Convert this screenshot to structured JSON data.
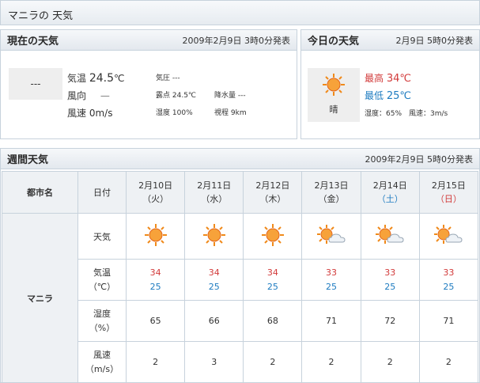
{
  "page_title": "マニラの 天気",
  "current": {
    "heading": "現在の天気",
    "issued": "2009年2月9日 3時0分発表",
    "icon_text": "---",
    "temp_label": "気温",
    "temp_value": "24.5",
    "temp_unit": "℃",
    "wind_dir_label": "風向",
    "wind_dir_value": "—",
    "wind_speed_label": "風速",
    "wind_speed_value": "0m/s",
    "pressure": "気圧 ---",
    "dewpoint_label": "露点",
    "dewpoint_value": "24.5℃",
    "precip": "降水量 ---",
    "humidity_label": "湿度",
    "humidity_value": "100%",
    "visibility_label": "視程",
    "visibility_value": "9km"
  },
  "today": {
    "heading": "今日の天気",
    "issued": "2月9日 5時0分発表",
    "condition": "晴",
    "high_label": "最高",
    "high_value": "34℃",
    "low_label": "最低",
    "low_value": "25℃",
    "detail": "湿度：65%　風速：3m/s"
  },
  "weekly": {
    "heading": "週間天気",
    "issued": "2009年2月9日 5時0分発表",
    "col_city": "都市名",
    "col_date": "日付",
    "city": "マニラ",
    "row_weather": "天気",
    "row_temp_l1": "気温",
    "row_temp_l2": "（℃）",
    "row_humidity_l1": "湿度",
    "row_humidity_l2": "（%）",
    "row_wind_l1": "風速",
    "row_wind_l2": "（m/s）",
    "days": [
      {
        "date": "2月10日",
        "dow": "（火）",
        "icon": "sun-icon",
        "high": "34",
        "low": "25",
        "humidity": "65",
        "wind": "2"
      },
      {
        "date": "2月11日",
        "dow": "（水）",
        "icon": "sun-icon",
        "high": "34",
        "low": "25",
        "humidity": "66",
        "wind": "3"
      },
      {
        "date": "2月12日",
        "dow": "（木）",
        "icon": "sun-icon",
        "high": "34",
        "low": "25",
        "humidity": "68",
        "wind": "2"
      },
      {
        "date": "2月13日",
        "dow": "（金）",
        "icon": "sun-cloud-icon",
        "high": "33",
        "low": "25",
        "humidity": "71",
        "wind": "2"
      },
      {
        "date": "2月14日",
        "dow": "（土）",
        "icon": "sun-cloud-icon",
        "high": "33",
        "low": "25",
        "humidity": "72",
        "wind": "2"
      },
      {
        "date": "2月15日",
        "dow": "（日）",
        "icon": "sun-cloud-icon",
        "high": "33",
        "low": "25",
        "humidity": "71",
        "wind": "2"
      }
    ]
  },
  "colors": {
    "high": "#d23a3a",
    "low": "#1d7bc0",
    "saturday": "#1d7bc0",
    "sunday": "#d23a3a"
  }
}
